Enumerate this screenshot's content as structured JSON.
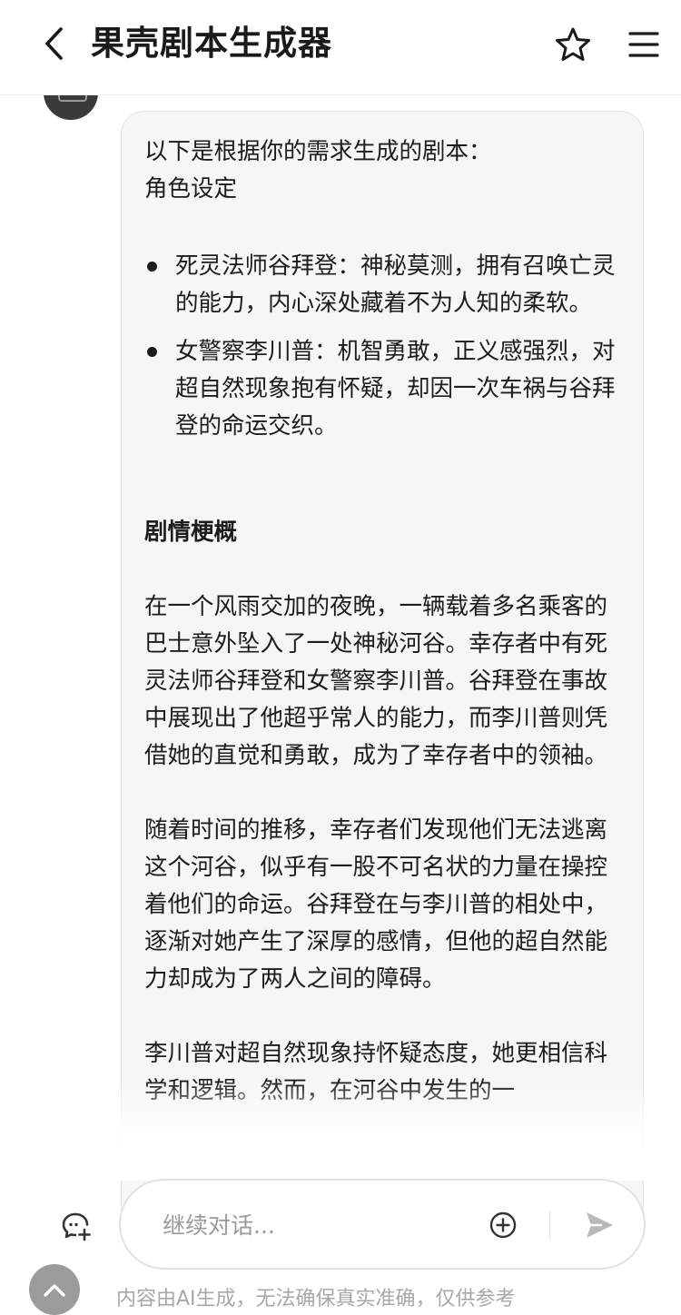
{
  "header": {
    "title": "果壳剧本生成器",
    "back_icon": "chevron-left-icon",
    "favorite_icon": "star-outline-icon",
    "menu_icon": "hamburger-menu-icon"
  },
  "message": {
    "intro": "以下是根据你的需求生成的剧本：",
    "roles_heading": "角色设定",
    "roles": [
      "死灵法师谷拜登：神秘莫测，拥有召唤亡灵的能力，内心深处藏着不为人知的柔软。",
      "女警察李川普：机智勇敢，正义感强烈，对超自然现象抱有怀疑，却因一次车祸与谷拜登的命运交织。"
    ],
    "plot_heading": "剧情梗概",
    "paragraphs": [
      "在一个风雨交加的夜晚，一辆载着多名乘客的巴士意外坠入了一处神秘河谷。幸存者中有死灵法师谷拜登和女警察李川普。谷拜登在事故中展现出了他超乎常人的能力，而李川普则凭借她的直觉和勇敢，成为了幸存者中的领袖。",
      "随着时间的推移，幸存者们发现他们无法逃离这个河谷，似乎有一股不可名状的力量在操控着他们的命运。谷拜登在与李川普的相处中，逐渐对她产生了深厚的感情，但他的超自然能力却成为了两人之间的障碍。",
      "李川普对超自然现象持怀疑态度，她更相信科学和逻辑。然而，在河谷中发生的一"
    ]
  },
  "composer": {
    "placeholder": "继续对话...",
    "new_chat_icon": "new-chat-icon",
    "attach_icon": "plus-circle-icon",
    "send_icon": "send-icon"
  },
  "footer": {
    "disclaimer": "内容由AI生成，无法确保真实准确，仅供参考",
    "scroll_icon": "chevron-up-icon"
  },
  "colors": {
    "bubble_bg": "#f6f6f6",
    "text": "#1c1c1c",
    "muted": "#9a9a9a",
    "avatar": "#3a3a3a"
  }
}
